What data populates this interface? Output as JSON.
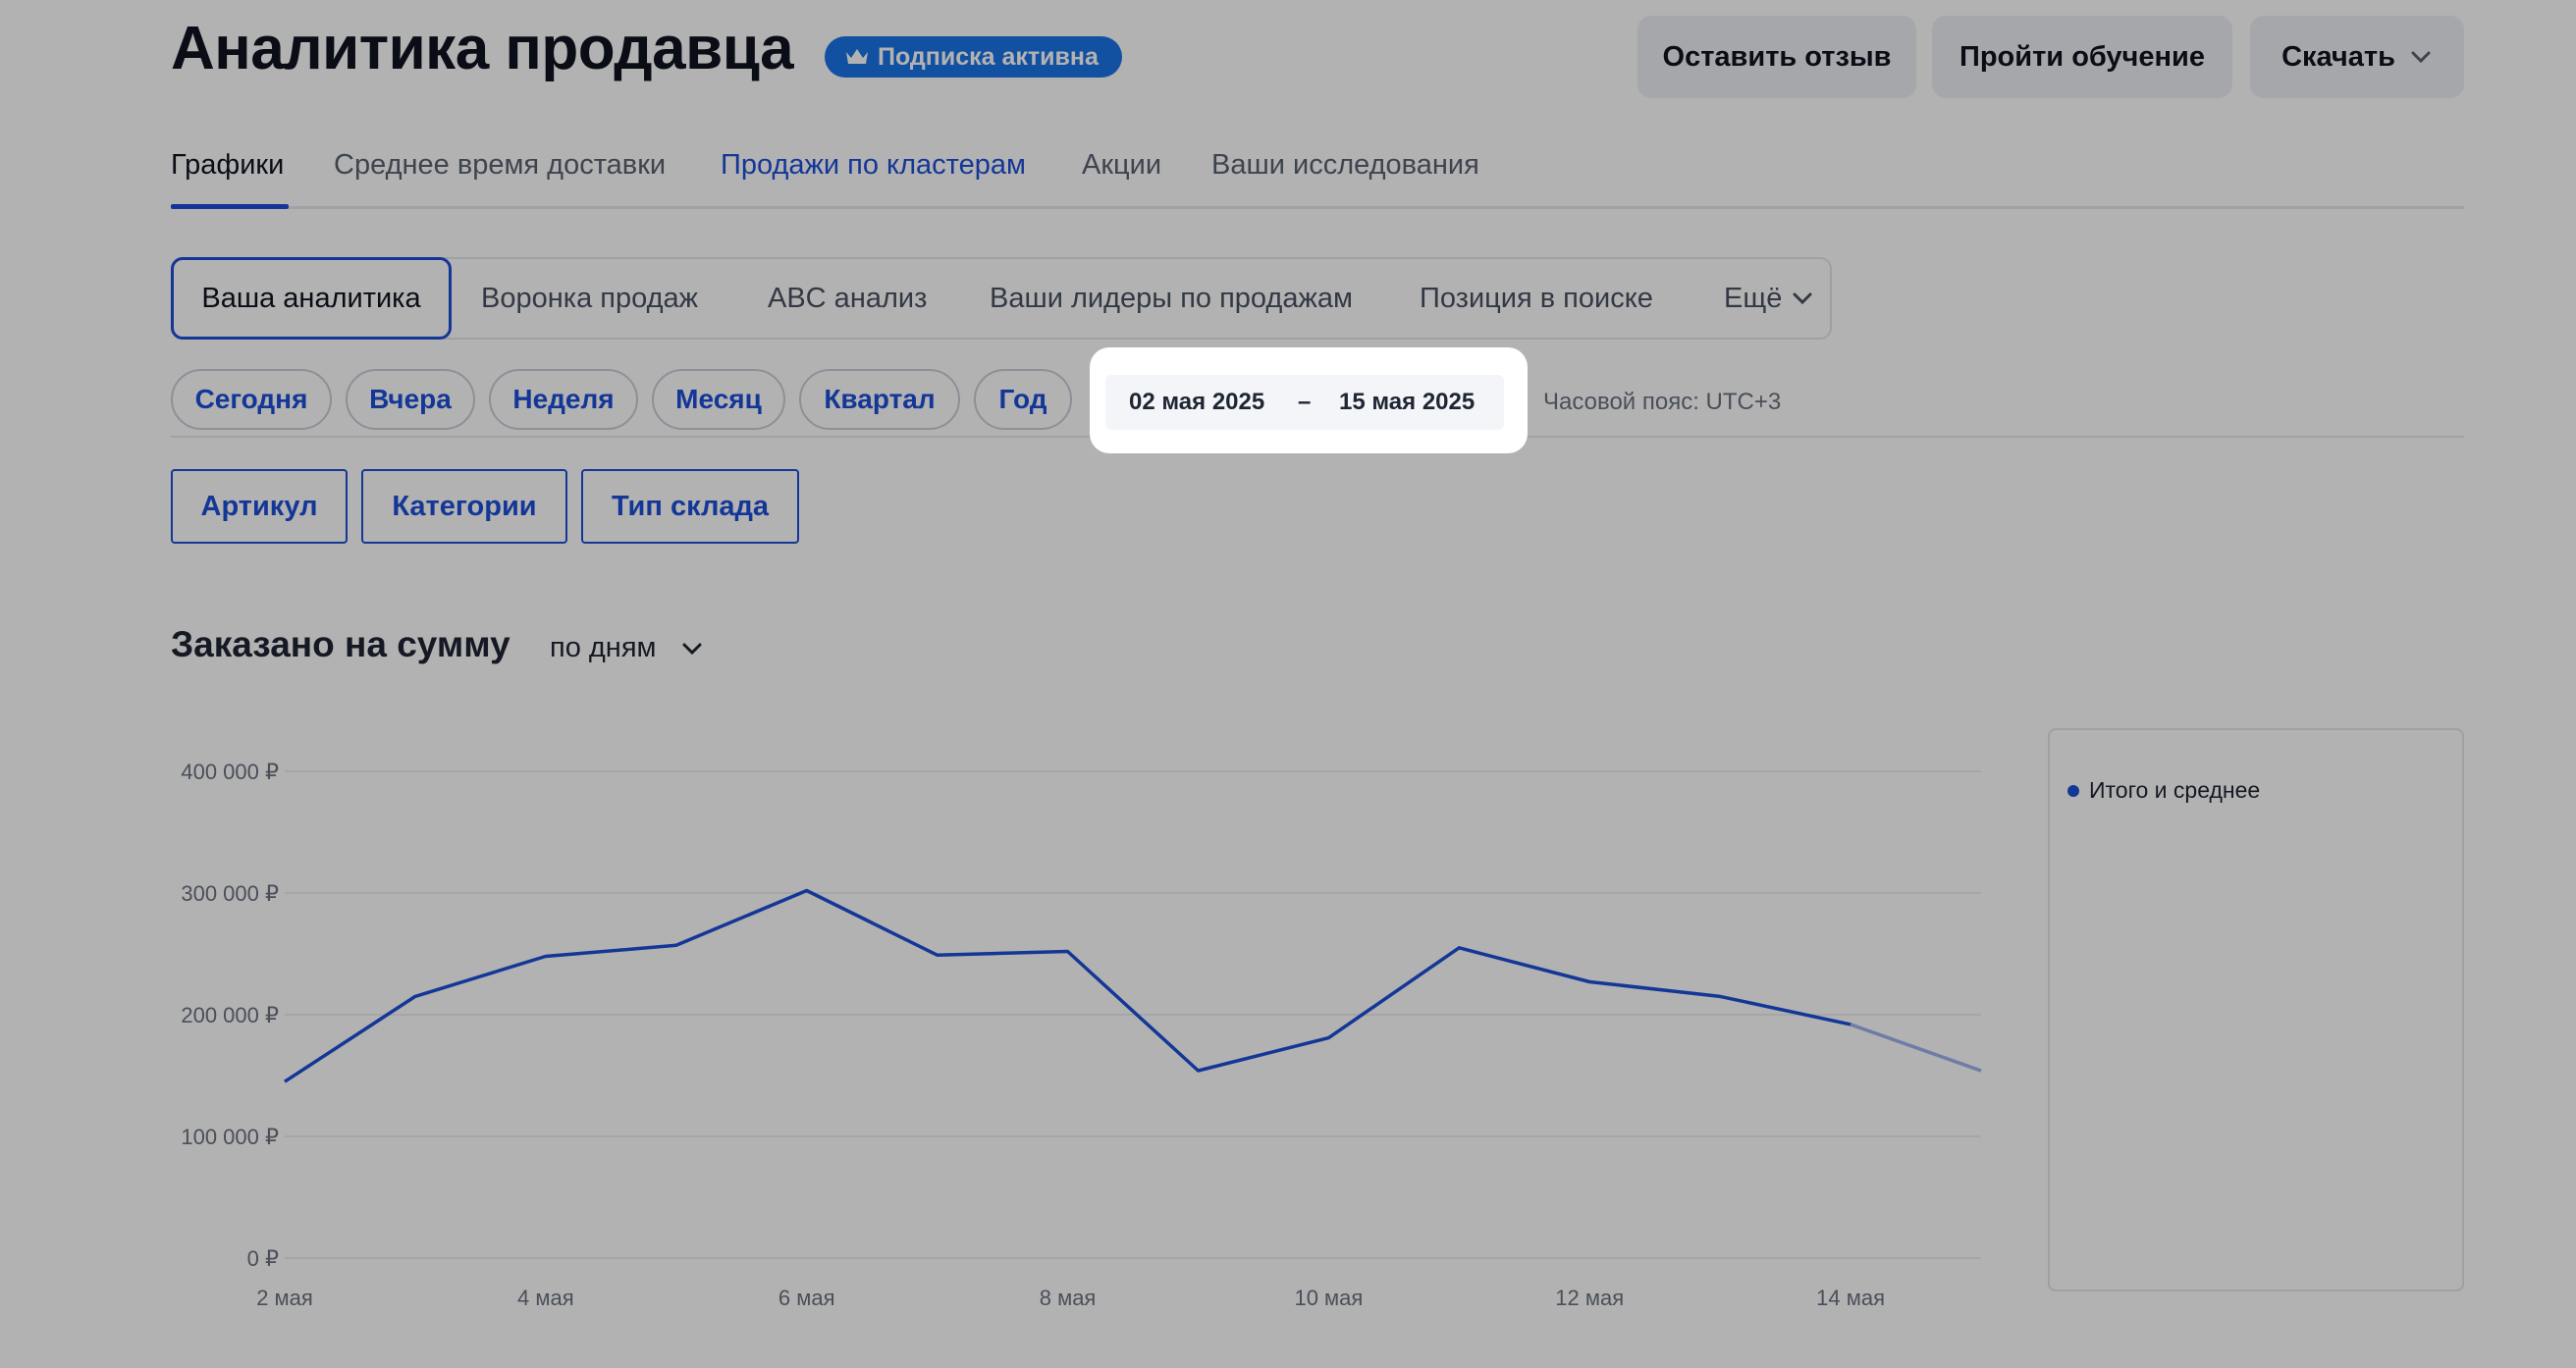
{
  "header": {
    "title": "Аналитика продавца",
    "badge": "Подписка активна",
    "buttons": {
      "feedback": "Оставить отзыв",
      "training": "Пройти обучение",
      "download": "Скачать"
    }
  },
  "tabs": [
    {
      "label": "Графики",
      "state": "active"
    },
    {
      "label": "Среднее время доставки",
      "state": "normal"
    },
    {
      "label": "Продажи по кластерам",
      "state": "link"
    },
    {
      "label": "Акции",
      "state": "normal"
    },
    {
      "label": "Ваши исследования",
      "state": "normal"
    }
  ],
  "segments": [
    "Ваша аналитика",
    "Воронка продаж",
    "ABC анализ",
    "Ваши лидеры по продажам",
    "Позиция в поиске",
    "Ещё"
  ],
  "periods": [
    "Сегодня",
    "Вчера",
    "Неделя",
    "Месяц",
    "Квартал",
    "Год"
  ],
  "date_range": {
    "from": "02 мая 2025",
    "separator": "–",
    "to": "15 мая 2025"
  },
  "timezone": "Часовой пояс: UTC+3",
  "filters": [
    "Артикул",
    "Категории",
    "Тип склада"
  ],
  "chart_section": {
    "title": "Заказано на сумму",
    "granularity": "по дням"
  },
  "legend": {
    "item": "Итого и среднее"
  },
  "colors": {
    "accent": "#1d4fd8",
    "badge": "#1a73e8"
  },
  "chart_data": {
    "type": "line",
    "title": "Заказано на сумму",
    "x": [
      "2 мая",
      "3 мая",
      "4 мая",
      "5 мая",
      "6 мая",
      "7 мая",
      "8 мая",
      "9 мая",
      "10 мая",
      "11 мая",
      "12 мая",
      "13 мая",
      "14 мая",
      "15 мая"
    ],
    "x_tick_labels": [
      "2 мая",
      "4 мая",
      "6 мая",
      "8 мая",
      "10 мая",
      "12 мая",
      "14 мая"
    ],
    "series": [
      {
        "name": "Итого и среднее",
        "values": [
          145000,
          215000,
          248000,
          257000,
          302000,
          249000,
          252000,
          154000,
          181000,
          255000,
          227000,
          215000,
          192000,
          154000
        ]
      }
    ],
    "y_ticks": [
      "0 ₽",
      "100 000 ₽",
      "200 000 ₽",
      "300 000 ₽",
      "400 000 ₽"
    ],
    "ylim": [
      0,
      400000
    ],
    "last_point_partial": true,
    "grid": true,
    "legend_position": "right"
  }
}
